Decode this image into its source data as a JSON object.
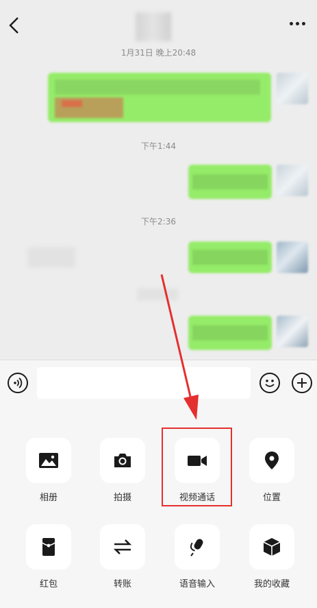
{
  "chat": {
    "timestamps": [
      "1月31日 晚上20:48",
      "下午1:44",
      "下午2:36"
    ]
  },
  "input": {
    "placeholder": ""
  },
  "panel": {
    "row1": [
      {
        "icon": "image-icon",
        "label": "相册"
      },
      {
        "icon": "camera-icon",
        "label": "拍摄"
      },
      {
        "icon": "video-camera-icon",
        "label": "视频通话"
      },
      {
        "icon": "location-pin-icon",
        "label": "位置"
      }
    ],
    "row2": [
      {
        "icon": "red-packet-icon",
        "label": "红包"
      },
      {
        "icon": "transfer-icon",
        "label": "转账"
      },
      {
        "icon": "microphone-icon",
        "label": "语音输入"
      },
      {
        "icon": "favorites-cube-icon",
        "label": "我的收藏"
      }
    ]
  },
  "colors": {
    "accent_highlight": "#e52f2f",
    "bubble_green": "#95ec69",
    "background": "#ededed"
  }
}
